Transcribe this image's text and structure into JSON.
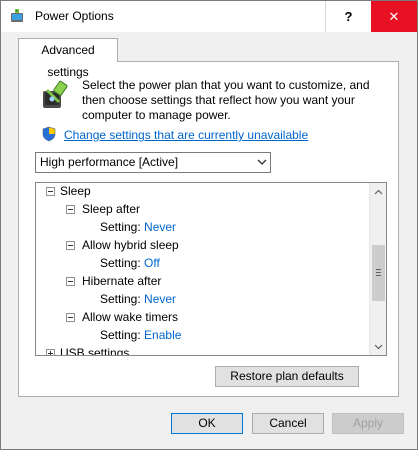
{
  "window": {
    "title": "Power Options",
    "help_label": "?",
    "close_label": "✕"
  },
  "tabs": [
    {
      "label": "Advanced settings"
    }
  ],
  "panel": {
    "description": "Select the power plan that you want to customize, and then choose settings that reflect how you want your computer to manage power.",
    "change_link": "Change settings that are currently unavailable",
    "plan_select": {
      "value": "High performance [Active]"
    }
  },
  "tree": {
    "items": [
      {
        "label": "Sleep"
      },
      {
        "label": "Sleep after"
      },
      {
        "setting_label": "Setting:",
        "value": "Never"
      },
      {
        "label": "Allow hybrid sleep"
      },
      {
        "setting_label": "Setting:",
        "value": "Off"
      },
      {
        "label": "Hibernate after"
      },
      {
        "setting_label": "Setting:",
        "value": "Never"
      },
      {
        "label": "Allow wake timers"
      },
      {
        "setting_label": "Setting:",
        "value": "Enable"
      },
      {
        "label": "USB settings"
      }
    ]
  },
  "buttons": {
    "restore": "Restore plan defaults",
    "ok": "OK",
    "cancel": "Cancel",
    "apply": "Apply"
  },
  "colors": {
    "link": "#0066cc",
    "close_button": "#e81123",
    "default_button_border": "#0078d7"
  }
}
